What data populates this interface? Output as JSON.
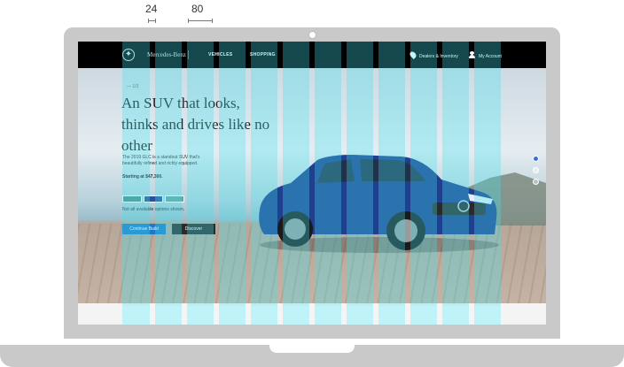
{
  "annotations": {
    "gutter": "24",
    "column": "80"
  },
  "nav": {
    "brand": "Mercedes-Benz",
    "links": [
      "VEHICLES",
      "SHOPPING"
    ],
    "dealers": "Dealers & Inventory",
    "account": "My Account"
  },
  "hero": {
    "page_indicator": "— 1/3",
    "headline": "An SUV that looks, thinks and drives like no other",
    "description": "The 2019 GLC is a standout SUV that's beautifully refined and richly equipped.",
    "price": "Starting at $47,300.",
    "disclaimer": "Not all available options shown.",
    "primary_button": "Continue Build",
    "secondary_button": "Discover"
  },
  "swatch_colors": [
    "#4f8f8a",
    "#2c4fa0",
    "#6aa3a3"
  ],
  "accent_color": "#1e78c8",
  "grid_overlay_color": "#40e4f0"
}
